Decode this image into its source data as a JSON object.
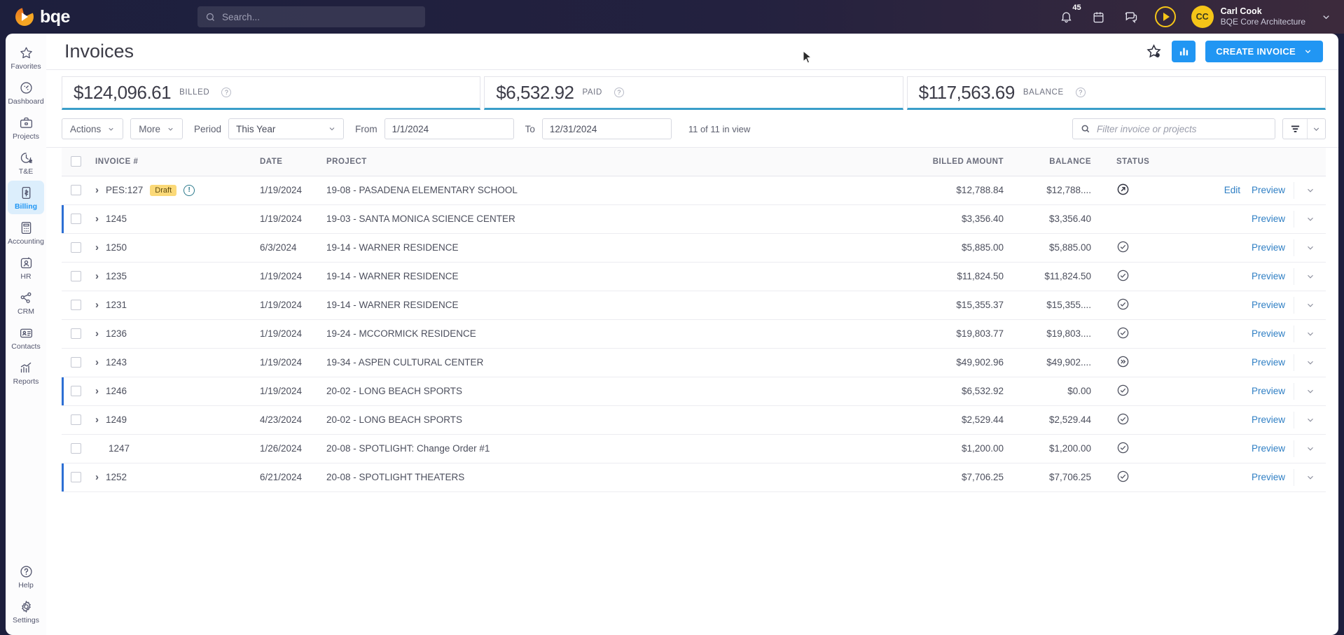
{
  "topbar": {
    "brand": "bqe",
    "search_placeholder": "Search...",
    "notifications_badge": "45",
    "user_name": "Carl Cook",
    "user_org": "BQE Core Architecture",
    "avatar_initials": "CC"
  },
  "sidebar": {
    "items": [
      {
        "label": "Favorites",
        "icon": "star-icon",
        "active": false
      },
      {
        "label": "Dashboard",
        "icon": "gauge-icon",
        "active": false
      },
      {
        "label": "Projects",
        "icon": "briefcase-icon",
        "active": false
      },
      {
        "label": "T&E",
        "icon": "clock-dollar-icon",
        "active": false
      },
      {
        "label": "Billing",
        "icon": "invoice-dollar-icon",
        "active": true
      },
      {
        "label": "Accounting",
        "icon": "calculator-icon",
        "active": false
      },
      {
        "label": "HR",
        "icon": "person-badge-icon",
        "active": false
      },
      {
        "label": "CRM",
        "icon": "share-nodes-icon",
        "active": false
      },
      {
        "label": "Contacts",
        "icon": "contact-card-icon",
        "active": false
      },
      {
        "label": "Reports",
        "icon": "bar-chart-icon",
        "active": false
      }
    ],
    "bottom_items": [
      {
        "label": "Help",
        "icon": "question-circle-icon"
      },
      {
        "label": "Settings",
        "icon": "gear-icon"
      }
    ]
  },
  "header": {
    "title": "Invoices",
    "create_button": "CREATE INVOICE"
  },
  "kpis": [
    {
      "amount": "$124,096.61",
      "label": "BILLED"
    },
    {
      "amount": "$6,532.92",
      "label": "PAID"
    },
    {
      "amount": "$117,563.69",
      "label": "BALANCE"
    }
  ],
  "toolbar": {
    "actions_label": "Actions",
    "more_label": "More",
    "period_label": "Period",
    "period_value": "This Year",
    "from_label": "From",
    "from_value": "1/1/2024",
    "to_label": "To",
    "to_value": "12/31/2024",
    "count_text": "11 of 11 in view",
    "filter_placeholder": "Filter invoice or projects"
  },
  "table": {
    "columns": {
      "invoice": "INVOICE #",
      "date": "DATE",
      "project": "PROJECT",
      "billed": "BILLED AMOUNT",
      "balance": "BALANCE",
      "status": "STATUS"
    },
    "actions": {
      "edit": "Edit",
      "preview": "Preview"
    },
    "rows": [
      {
        "invoice": "PES:127",
        "badge": "Draft",
        "has_warning": true,
        "expandable": true,
        "date": "1/19/2024",
        "project": "19-08 - PASADENA ELEMENTARY SCHOOL",
        "billed": "$12,788.84",
        "balance": "$12,788....",
        "status": "sent-arrow-icon",
        "edit": true,
        "preview": true,
        "marked": false
      },
      {
        "invoice": "1245",
        "badge": "",
        "has_warning": false,
        "expandable": true,
        "date": "1/19/2024",
        "project": "19-03 - SANTA MONICA SCIENCE CENTER",
        "billed": "$3,356.40",
        "balance": "$3,356.40",
        "status": "",
        "edit": false,
        "preview": true,
        "marked": true
      },
      {
        "invoice": "1250",
        "badge": "",
        "has_warning": false,
        "expandable": true,
        "date": "6/3/2024",
        "project": "19-14 - WARNER RESIDENCE",
        "billed": "$5,885.00",
        "balance": "$5,885.00",
        "status": "check-circle-icon",
        "edit": false,
        "preview": true,
        "marked": false
      },
      {
        "invoice": "1235",
        "badge": "",
        "has_warning": false,
        "expandable": true,
        "date": "1/19/2024",
        "project": "19-14 - WARNER RESIDENCE",
        "billed": "$11,824.50",
        "balance": "$11,824.50",
        "status": "check-circle-icon",
        "edit": false,
        "preview": true,
        "marked": false
      },
      {
        "invoice": "1231",
        "badge": "",
        "has_warning": false,
        "expandable": true,
        "date": "1/19/2024",
        "project": "19-14 - WARNER RESIDENCE",
        "billed": "$15,355.37",
        "balance": "$15,355....",
        "status": "check-circle-icon",
        "edit": false,
        "preview": true,
        "marked": false
      },
      {
        "invoice": "1236",
        "badge": "",
        "has_warning": false,
        "expandable": true,
        "date": "1/19/2024",
        "project": "19-24 - MCCORMICK RESIDENCE",
        "billed": "$19,803.77",
        "balance": "$19,803....",
        "status": "check-circle-icon",
        "edit": false,
        "preview": true,
        "marked": false
      },
      {
        "invoice": "1243",
        "badge": "",
        "has_warning": false,
        "expandable": true,
        "date": "1/19/2024",
        "project": "19-34 - ASPEN CULTURAL CENTER",
        "billed": "$49,902.96",
        "balance": "$49,902....",
        "status": "double-chevron-circle-icon",
        "edit": false,
        "preview": true,
        "marked": false
      },
      {
        "invoice": "1246",
        "badge": "",
        "has_warning": false,
        "expandable": true,
        "date": "1/19/2024",
        "project": "20-02 - LONG BEACH SPORTS",
        "billed": "$6,532.92",
        "balance": "$0.00",
        "status": "check-circle-icon",
        "edit": false,
        "preview": true,
        "marked": true
      },
      {
        "invoice": "1249",
        "badge": "",
        "has_warning": false,
        "expandable": true,
        "date": "4/23/2024",
        "project": "20-02 - LONG BEACH SPORTS",
        "billed": "$2,529.44",
        "balance": "$2,529.44",
        "status": "check-circle-icon",
        "edit": false,
        "preview": true,
        "marked": false
      },
      {
        "invoice": "1247",
        "badge": "",
        "has_warning": false,
        "expandable": false,
        "date": "1/26/2024",
        "project": "20-08 - SPOTLIGHT: Change Order #1",
        "billed": "$1,200.00",
        "balance": "$1,200.00",
        "status": "check-circle-icon",
        "edit": false,
        "preview": true,
        "marked": false
      },
      {
        "invoice": "1252",
        "badge": "",
        "has_warning": false,
        "expandable": true,
        "date": "6/21/2024",
        "project": "20-08 - SPOTLIGHT THEATERS",
        "billed": "$7,706.25",
        "balance": "$7,706.25",
        "status": "check-circle-icon",
        "edit": false,
        "preview": true,
        "marked": true
      }
    ]
  },
  "colors": {
    "accent": "#2196f3",
    "kpi_underline": "#3a9ec9",
    "draft_badge": "#fbd978",
    "row_marker": "#2d6fd4"
  }
}
